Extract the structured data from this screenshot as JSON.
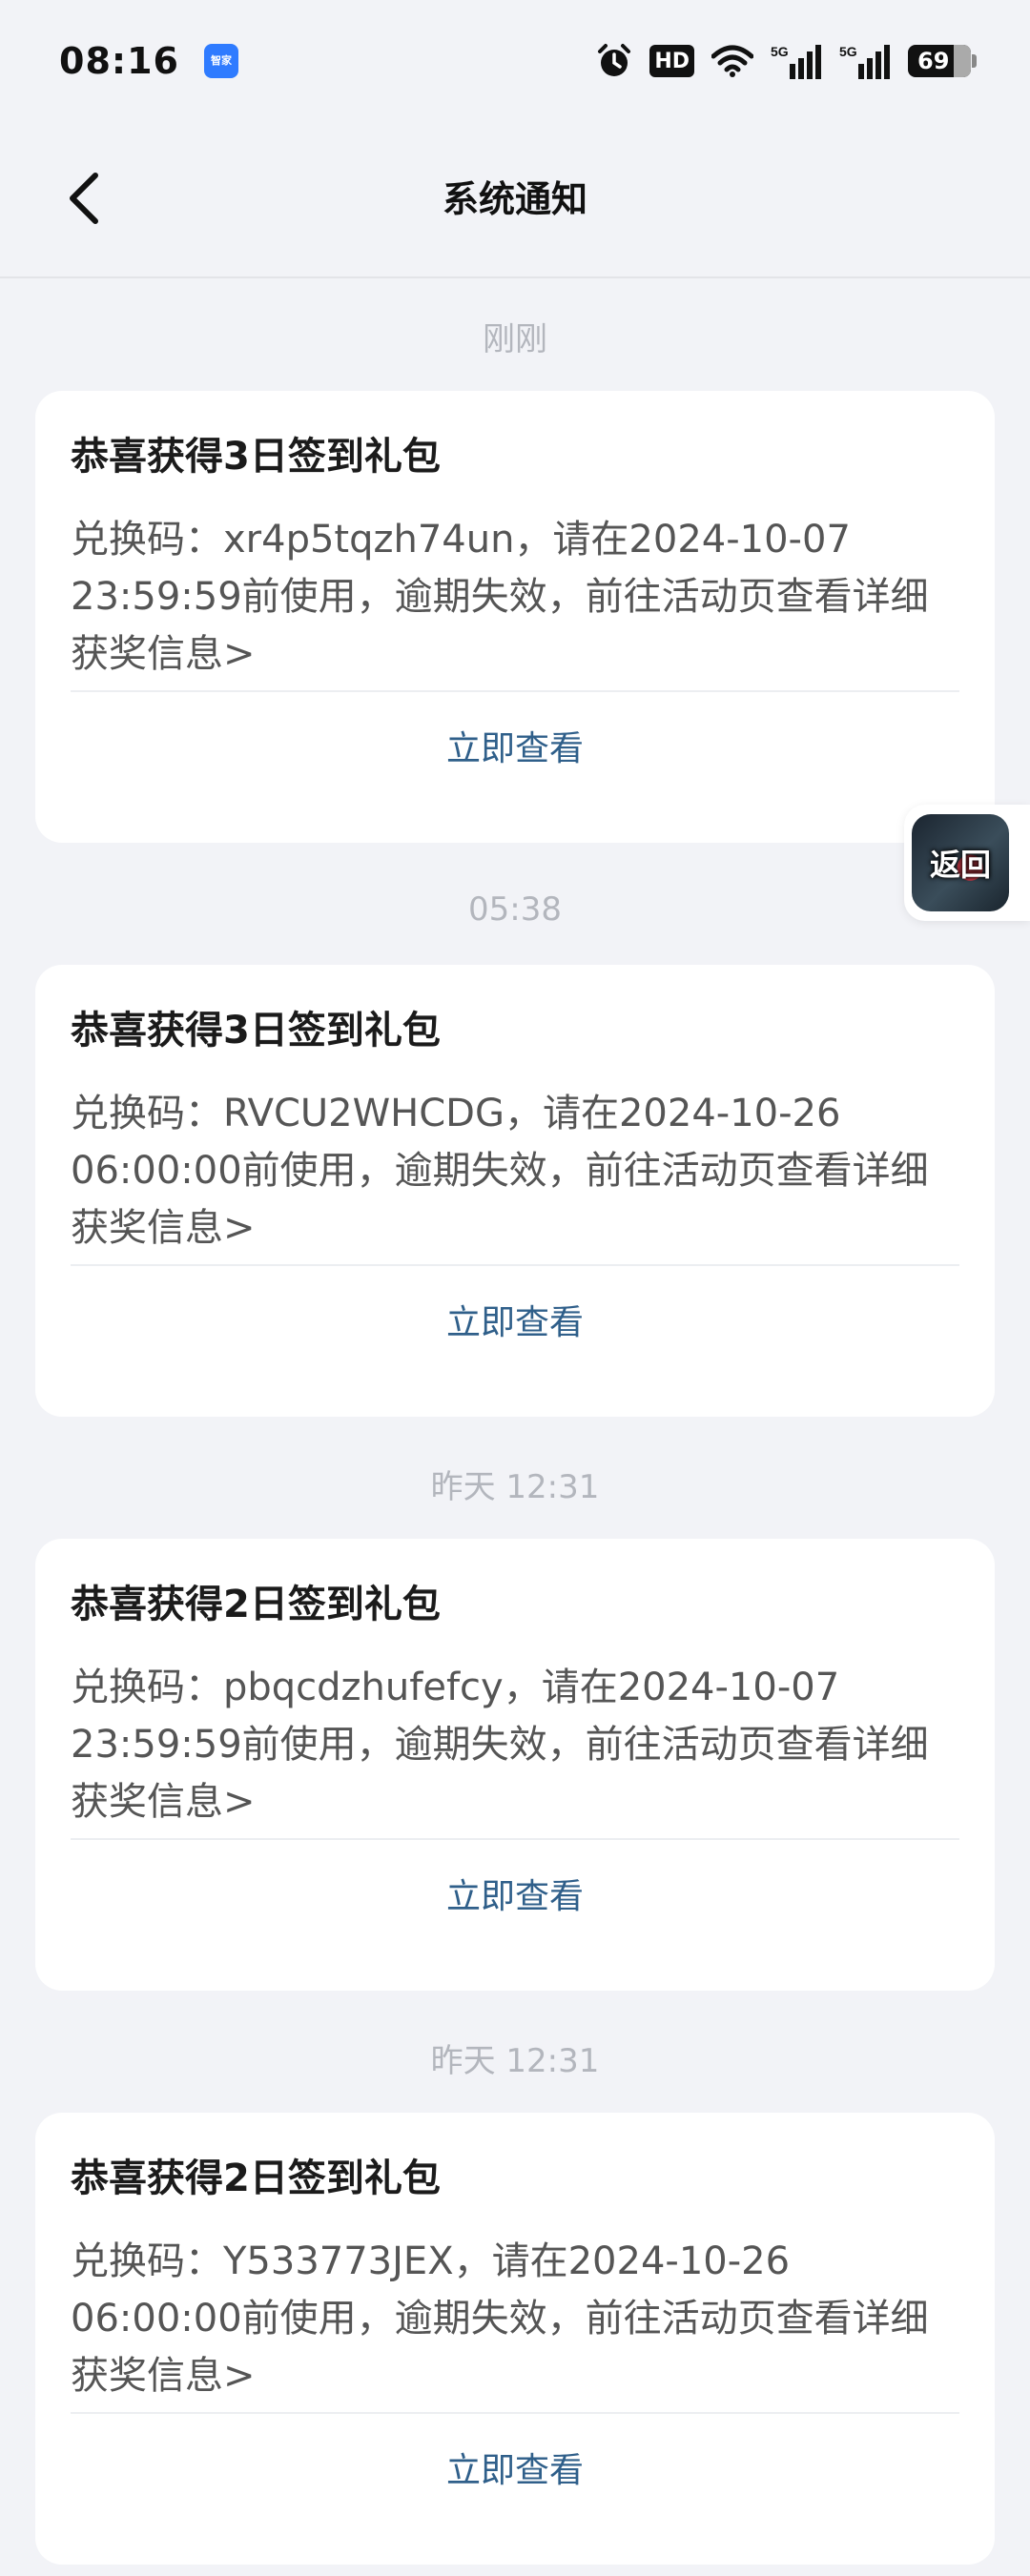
{
  "status_bar": {
    "time": "08:16",
    "app_badge": "智家",
    "network_1": "5G",
    "network_2": "5G",
    "hd": "HD",
    "battery": "69"
  },
  "nav": {
    "title": "系统通知"
  },
  "float_button": {
    "label": "返回"
  },
  "notifications": [
    {
      "time": "刚刚",
      "title": "恭喜获得3日签到礼包",
      "body": "兑换码：xr4p5tqzh74un，请在2024-10-07 23:59:59前使用，逾期失效，前往活动页查看详细获奖信息>",
      "action": "立即查看"
    },
    {
      "time": "05:38",
      "title": "恭喜获得3日签到礼包",
      "body": "兑换码：RVCU2WHCDG，请在2024-10-26 06:00:00前使用，逾期失效，前往活动页查看详细获奖信息>",
      "action": "立即查看"
    },
    {
      "time": "昨天  12:31",
      "title": "恭喜获得2日签到礼包",
      "body": "兑换码：pbqcdzhufefcy，请在2024-10-07 23:59:59前使用，逾期失效，前往活动页查看详细获奖信息>",
      "action": "立即查看"
    },
    {
      "time": "昨天  12:31",
      "title": "恭喜获得2日签到礼包",
      "body": "兑换码：Y533773JEX，请在2024-10-26 06:00:00前使用，逾期失效，前往活动页查看详细获奖信息>",
      "action": "立即查看"
    }
  ]
}
